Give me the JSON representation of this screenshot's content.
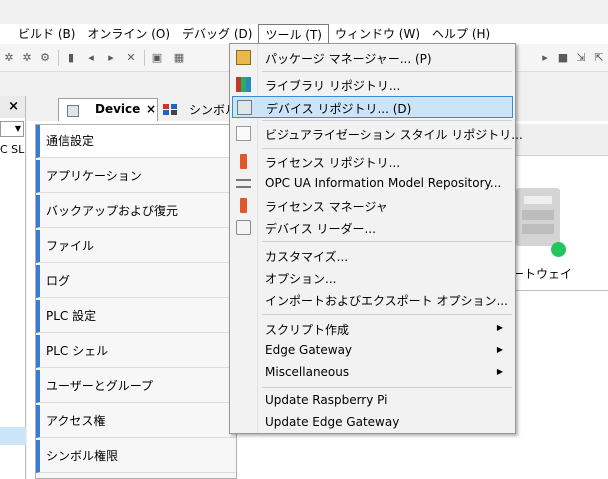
{
  "menubar": {
    "items": [
      {
        "label": "ビルド (B)"
      },
      {
        "label": "オンライン (O)"
      },
      {
        "label": "デバッグ (D)"
      },
      {
        "label": "ツール (T)"
      },
      {
        "label": "ウィンドウ (W)"
      },
      {
        "label": "ヘルプ (H)"
      }
    ]
  },
  "leftpane": {
    "close_label": "×",
    "truncated_text": "C SL"
  },
  "tabs": [
    {
      "label": "Device",
      "close": "×"
    },
    {
      "label": "シンボル構成"
    }
  ],
  "sidebar": {
    "items": [
      {
        "label": "通信設定"
      },
      {
        "label": "アプリケーション"
      },
      {
        "label": "バックアップおよび復元"
      },
      {
        "label": "ファイル"
      },
      {
        "label": "ログ"
      },
      {
        "label": "PLC 設定"
      },
      {
        "label": "PLC シェル"
      },
      {
        "label": "ユーザーとグループ"
      },
      {
        "label": "アクセス権"
      },
      {
        "label": "シンボル権限"
      }
    ]
  },
  "content": {
    "gateway_label": "ートウェイ",
    "status_color": "#22c55e"
  },
  "tools_menu": {
    "items": [
      {
        "label": "パッケージ マネージャー... (P)",
        "icon": "package-icon"
      },
      {
        "label": "ライブラリ リポジトリ...",
        "icon": "library-icon"
      },
      {
        "label": "デバイス リポジトリ... (D)",
        "icon": "device-icon",
        "highlighted": true
      },
      {
        "label": "ビジュアライゼーション スタイル リポジトリ...",
        "icon": "visualization-icon"
      },
      {
        "label": "ライセンス リポジトリ...",
        "icon": "license-icon"
      },
      {
        "label": "OPC UA Information Model Repository...",
        "icon": "opcua-icon"
      },
      {
        "label": "ライセンス マネージャ",
        "icon": "license-manager-icon"
      },
      {
        "label": "デバイス リーダー...",
        "icon": "device-reader-icon"
      },
      {
        "label": "カスタマイズ..."
      },
      {
        "label": "オプション..."
      },
      {
        "label": "インポートおよびエクスポート オプション..."
      },
      {
        "label": "スクリプト作成",
        "submenu": true
      },
      {
        "label": "Edge Gateway",
        "submenu": true
      },
      {
        "label": "Miscellaneous",
        "submenu": true
      },
      {
        "label": "Update Raspberry Pi"
      },
      {
        "label": "Update Edge Gateway"
      }
    ],
    "submenu_arrow": "▶"
  }
}
